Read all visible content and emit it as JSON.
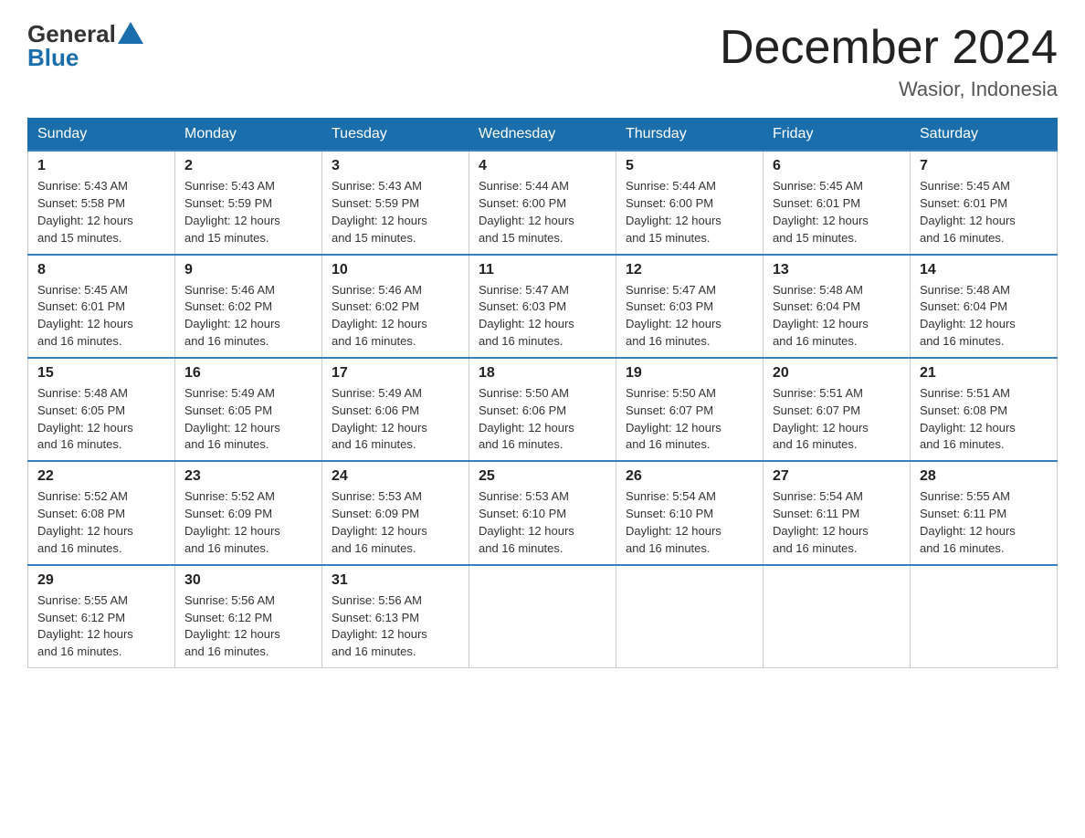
{
  "logo": {
    "general": "General",
    "blue": "Blue"
  },
  "title": "December 2024",
  "location": "Wasior, Indonesia",
  "days_of_week": [
    "Sunday",
    "Monday",
    "Tuesday",
    "Wednesday",
    "Thursday",
    "Friday",
    "Saturday"
  ],
  "weeks": [
    [
      {
        "day": "1",
        "sunrise": "5:43 AM",
        "sunset": "5:58 PM",
        "daylight": "12 hours and 15 minutes."
      },
      {
        "day": "2",
        "sunrise": "5:43 AM",
        "sunset": "5:59 PM",
        "daylight": "12 hours and 15 minutes."
      },
      {
        "day": "3",
        "sunrise": "5:43 AM",
        "sunset": "5:59 PM",
        "daylight": "12 hours and 15 minutes."
      },
      {
        "day": "4",
        "sunrise": "5:44 AM",
        "sunset": "6:00 PM",
        "daylight": "12 hours and 15 minutes."
      },
      {
        "day": "5",
        "sunrise": "5:44 AM",
        "sunset": "6:00 PM",
        "daylight": "12 hours and 15 minutes."
      },
      {
        "day": "6",
        "sunrise": "5:45 AM",
        "sunset": "6:01 PM",
        "daylight": "12 hours and 15 minutes."
      },
      {
        "day": "7",
        "sunrise": "5:45 AM",
        "sunset": "6:01 PM",
        "daylight": "12 hours and 16 minutes."
      }
    ],
    [
      {
        "day": "8",
        "sunrise": "5:45 AM",
        "sunset": "6:01 PM",
        "daylight": "12 hours and 16 minutes."
      },
      {
        "day": "9",
        "sunrise": "5:46 AM",
        "sunset": "6:02 PM",
        "daylight": "12 hours and 16 minutes."
      },
      {
        "day": "10",
        "sunrise": "5:46 AM",
        "sunset": "6:02 PM",
        "daylight": "12 hours and 16 minutes."
      },
      {
        "day": "11",
        "sunrise": "5:47 AM",
        "sunset": "6:03 PM",
        "daylight": "12 hours and 16 minutes."
      },
      {
        "day": "12",
        "sunrise": "5:47 AM",
        "sunset": "6:03 PM",
        "daylight": "12 hours and 16 minutes."
      },
      {
        "day": "13",
        "sunrise": "5:48 AM",
        "sunset": "6:04 PM",
        "daylight": "12 hours and 16 minutes."
      },
      {
        "day": "14",
        "sunrise": "5:48 AM",
        "sunset": "6:04 PM",
        "daylight": "12 hours and 16 minutes."
      }
    ],
    [
      {
        "day": "15",
        "sunrise": "5:48 AM",
        "sunset": "6:05 PM",
        "daylight": "12 hours and 16 minutes."
      },
      {
        "day": "16",
        "sunrise": "5:49 AM",
        "sunset": "6:05 PM",
        "daylight": "12 hours and 16 minutes."
      },
      {
        "day": "17",
        "sunrise": "5:49 AM",
        "sunset": "6:06 PM",
        "daylight": "12 hours and 16 minutes."
      },
      {
        "day": "18",
        "sunrise": "5:50 AM",
        "sunset": "6:06 PM",
        "daylight": "12 hours and 16 minutes."
      },
      {
        "day": "19",
        "sunrise": "5:50 AM",
        "sunset": "6:07 PM",
        "daylight": "12 hours and 16 minutes."
      },
      {
        "day": "20",
        "sunrise": "5:51 AM",
        "sunset": "6:07 PM",
        "daylight": "12 hours and 16 minutes."
      },
      {
        "day": "21",
        "sunrise": "5:51 AM",
        "sunset": "6:08 PM",
        "daylight": "12 hours and 16 minutes."
      }
    ],
    [
      {
        "day": "22",
        "sunrise": "5:52 AM",
        "sunset": "6:08 PM",
        "daylight": "12 hours and 16 minutes."
      },
      {
        "day": "23",
        "sunrise": "5:52 AM",
        "sunset": "6:09 PM",
        "daylight": "12 hours and 16 minutes."
      },
      {
        "day": "24",
        "sunrise": "5:53 AM",
        "sunset": "6:09 PM",
        "daylight": "12 hours and 16 minutes."
      },
      {
        "day": "25",
        "sunrise": "5:53 AM",
        "sunset": "6:10 PM",
        "daylight": "12 hours and 16 minutes."
      },
      {
        "day": "26",
        "sunrise": "5:54 AM",
        "sunset": "6:10 PM",
        "daylight": "12 hours and 16 minutes."
      },
      {
        "day": "27",
        "sunrise": "5:54 AM",
        "sunset": "6:11 PM",
        "daylight": "12 hours and 16 minutes."
      },
      {
        "day": "28",
        "sunrise": "5:55 AM",
        "sunset": "6:11 PM",
        "daylight": "12 hours and 16 minutes."
      }
    ],
    [
      {
        "day": "29",
        "sunrise": "5:55 AM",
        "sunset": "6:12 PM",
        "daylight": "12 hours and 16 minutes."
      },
      {
        "day": "30",
        "sunrise": "5:56 AM",
        "sunset": "6:12 PM",
        "daylight": "12 hours and 16 minutes."
      },
      {
        "day": "31",
        "sunrise": "5:56 AM",
        "sunset": "6:13 PM",
        "daylight": "12 hours and 16 minutes."
      },
      null,
      null,
      null,
      null
    ]
  ],
  "labels": {
    "sunrise": "Sunrise:",
    "sunset": "Sunset:",
    "daylight": "Daylight:"
  }
}
